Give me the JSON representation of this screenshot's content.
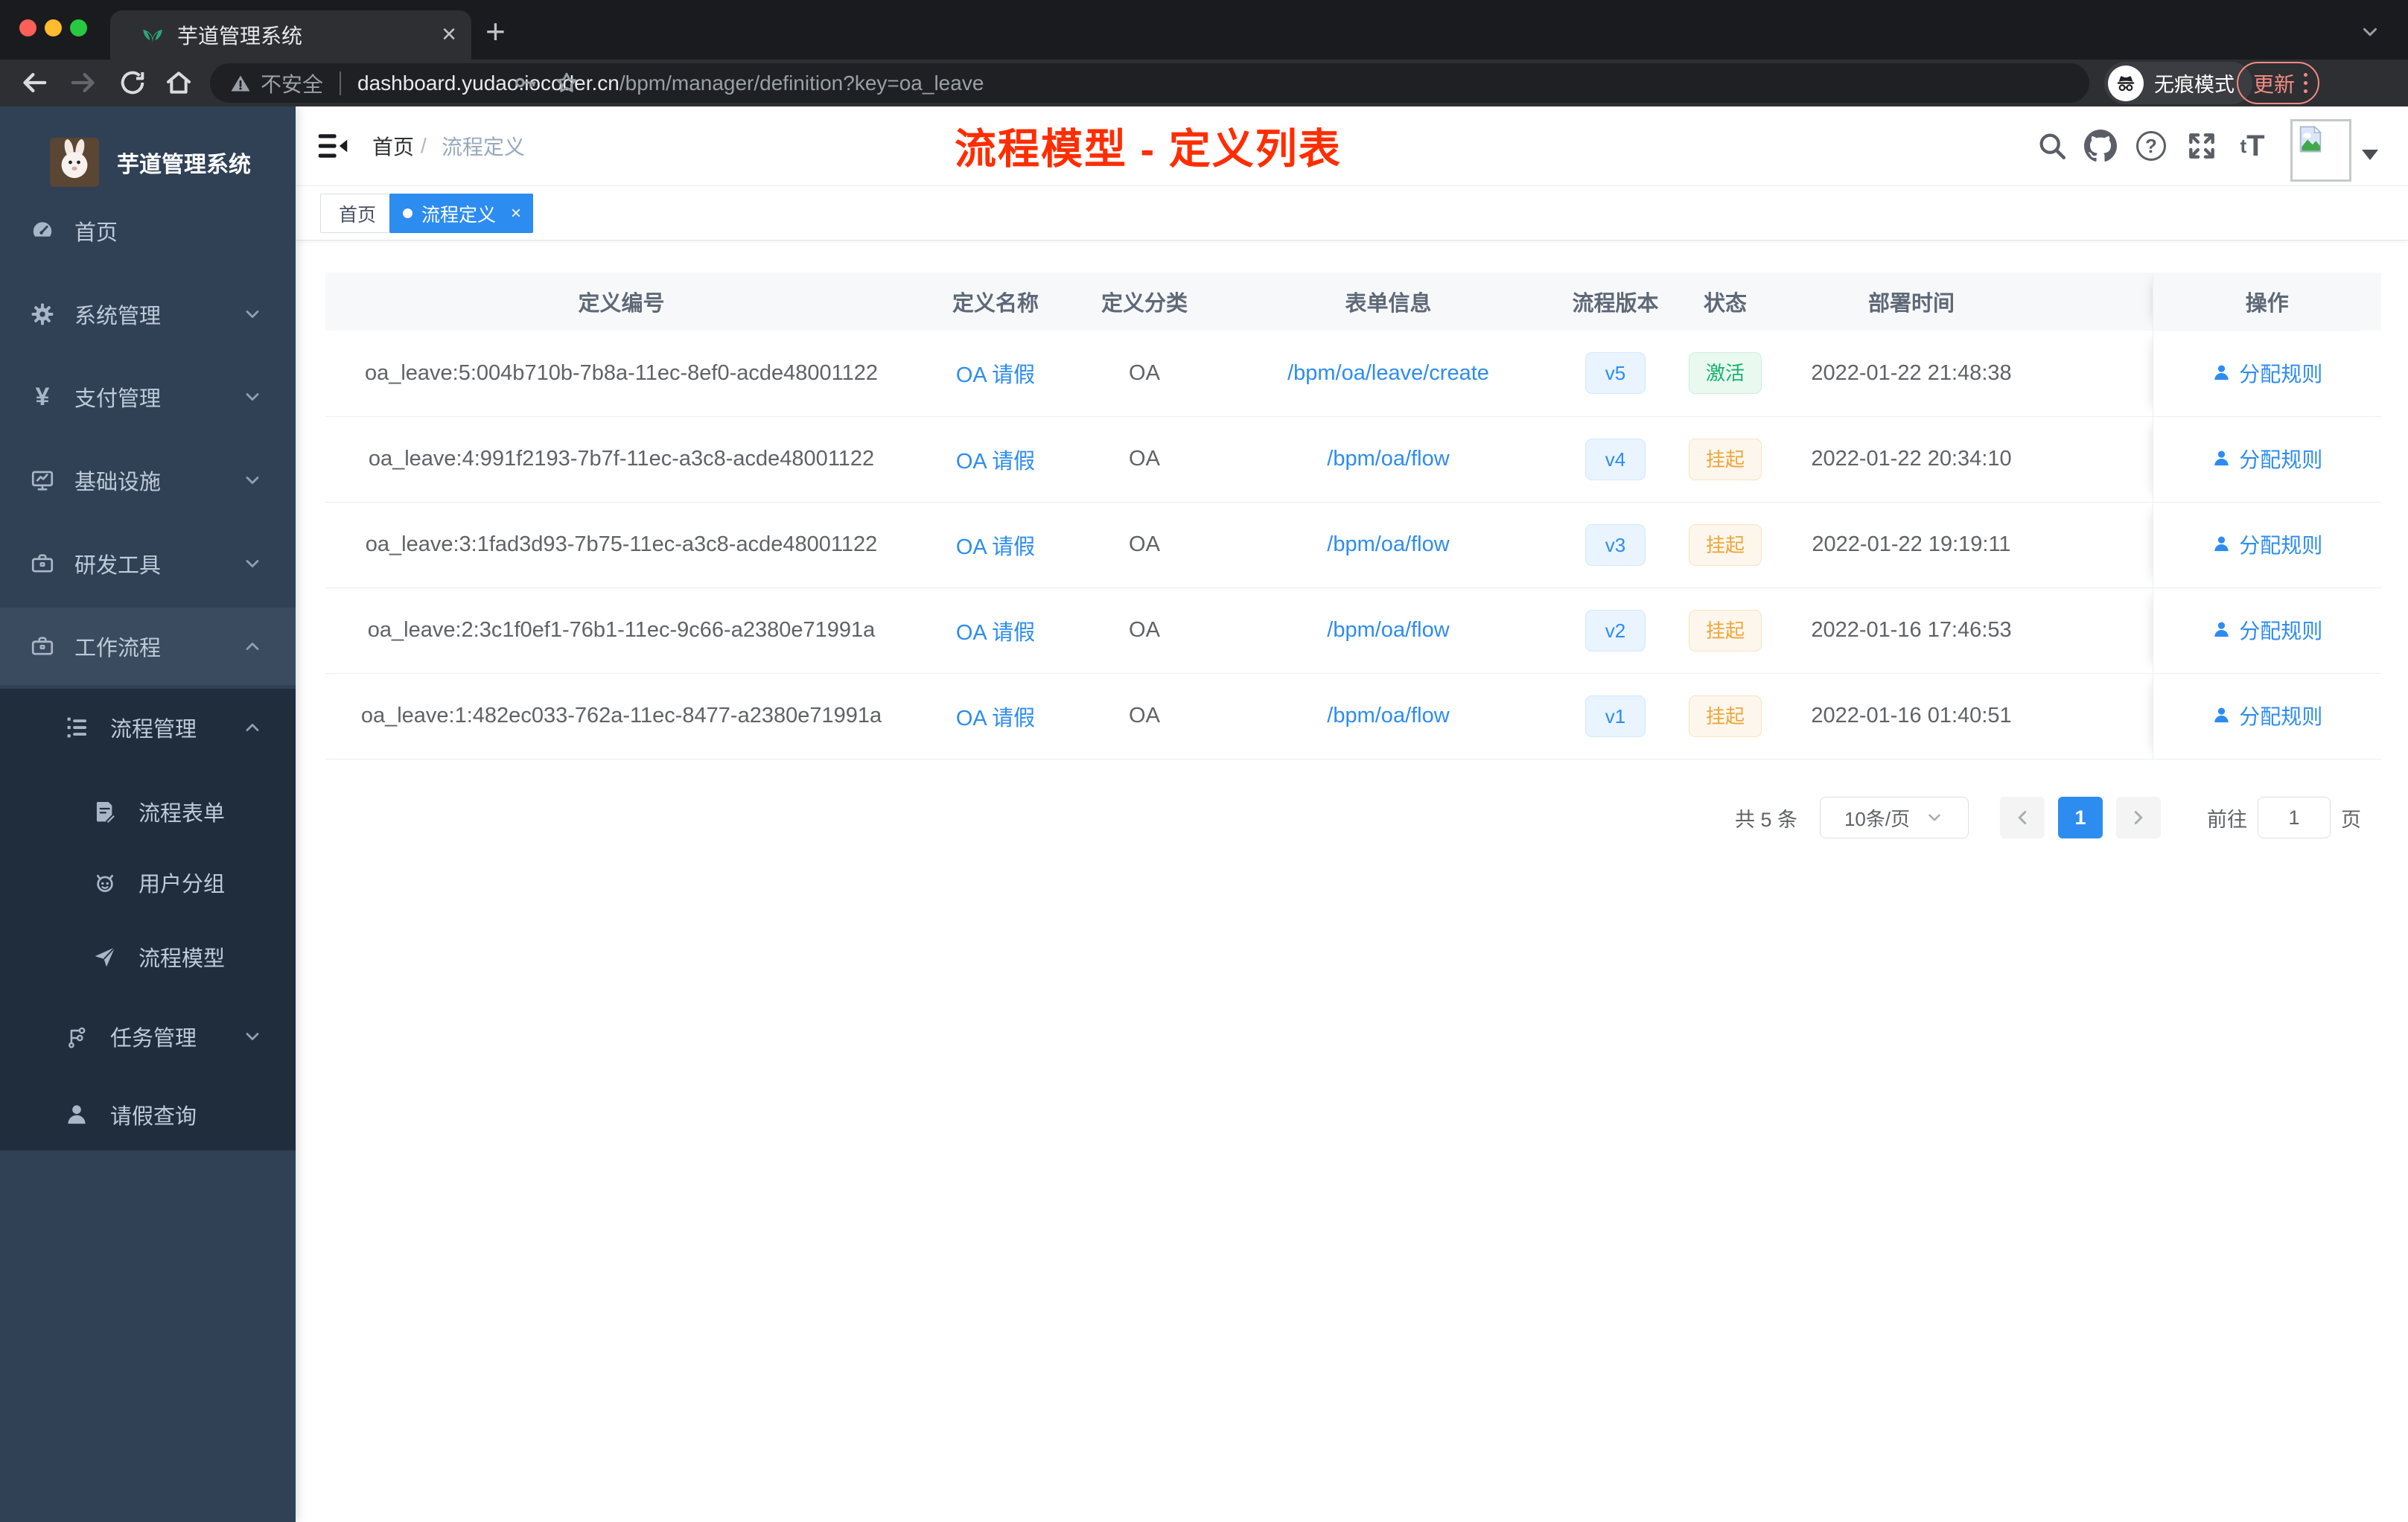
{
  "browser": {
    "tab": {
      "title": "芋道管理系统",
      "close": "×"
    },
    "new_tab": "+",
    "toolbar": {
      "security": "不安全",
      "url_host": "dashboard.yudao.iocoder.cn",
      "url_path": "/bpm/manager/definition?key=oa_leave",
      "incognito_label": "无痕模式",
      "update_label": "更新"
    }
  },
  "sidebar": {
    "title": "芋道管理系统",
    "items": [
      {
        "label": "首页",
        "icon": "dashboard-icon"
      },
      {
        "label": "系统管理",
        "icon": "gear-icon"
      },
      {
        "label": "支付管理",
        "icon": "yen-icon"
      },
      {
        "label": "基础设施",
        "icon": "monitor-icon"
      },
      {
        "label": "研发工具",
        "icon": "toolbox-icon"
      },
      {
        "label": "工作流程",
        "icon": "briefcase-icon"
      },
      {
        "label": "流程管理",
        "icon": "list-tree-icon"
      },
      {
        "label": "流程表单",
        "icon": "form-icon"
      },
      {
        "label": "用户分组",
        "icon": "robot-icon"
      },
      {
        "label": "流程模型",
        "icon": "paper-plane-icon"
      },
      {
        "label": "任务管理",
        "icon": "org-tree-icon"
      },
      {
        "label": "请假查询",
        "icon": "user-icon"
      }
    ]
  },
  "header": {
    "breadcrumb_home": "首页",
    "breadcrumb_sep": "/",
    "breadcrumb_current": "流程定义",
    "annotation": "流程模型 - 定义列表",
    "help_icon_label": "?",
    "font_icon_small": "t",
    "font_icon_big": "T"
  },
  "tags": {
    "home": "首页",
    "active": "流程定义",
    "close": "×"
  },
  "table": {
    "columns": [
      "定义编号",
      "定义名称",
      "定义分类",
      "表单信息",
      "流程版本",
      "状态",
      "部署时间",
      "操作"
    ],
    "rows": [
      {
        "id": "oa_leave:5:004b710b-7b8a-11ec-8ef0-acde48001122",
        "name": "OA 请假",
        "category": "OA",
        "form": "/bpm/oa/leave/create",
        "version": "v5",
        "status": "激活",
        "time": "2022-01-22 21:48:38",
        "action": "分配规则"
      },
      {
        "id": "oa_leave:4:991f2193-7b7f-11ec-a3c8-acde48001122",
        "name": "OA 请假",
        "category": "OA",
        "form": "/bpm/oa/flow",
        "version": "v4",
        "status": "挂起",
        "time": "2022-01-22 20:34:10",
        "action": "分配规则"
      },
      {
        "id": "oa_leave:3:1fad3d93-7b75-11ec-a3c8-acde48001122",
        "name": "OA 请假",
        "category": "OA",
        "form": "/bpm/oa/flow",
        "version": "v3",
        "status": "挂起",
        "time": "2022-01-22 19:19:11",
        "action": "分配规则"
      },
      {
        "id": "oa_leave:2:3c1f0ef1-76b1-11ec-9c66-a2380e71991a",
        "name": "OA 请假",
        "category": "OA",
        "form": "/bpm/oa/flow",
        "version": "v2",
        "status": "挂起",
        "time": "2022-01-16 17:46:53",
        "action": "分配规则"
      },
      {
        "id": "oa_leave:1:482ec033-762a-11ec-8477-a2380e71991a",
        "name": "OA 请假",
        "category": "OA",
        "form": "/bpm/oa/flow",
        "version": "v1",
        "status": "挂起",
        "time": "2022-01-16 01:40:51",
        "action": "分配规则"
      }
    ]
  },
  "pagination": {
    "total": "共 5 条",
    "page_size": "10条/页",
    "page": "1",
    "goto_label": "前往",
    "goto_value": "1",
    "unit": "页"
  },
  "colors": {
    "accent": "#2d8cf0",
    "success": "#16b26d",
    "warning": "#eda73c",
    "annotation_red": "#ff2d00",
    "sidebar_bg": "#304156",
    "submenu_bg": "#1f2d3d"
  }
}
